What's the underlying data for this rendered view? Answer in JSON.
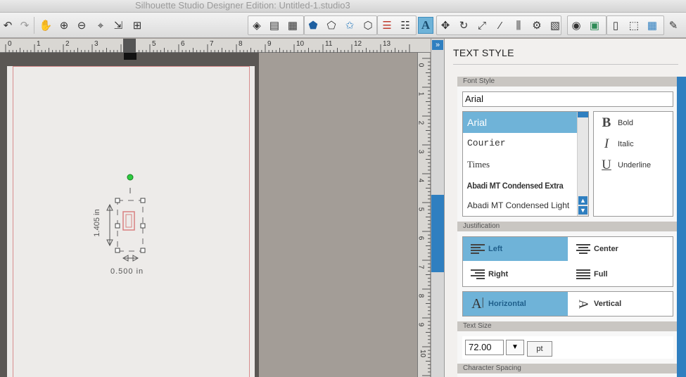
{
  "window": {
    "title": "Silhouette Studio Designer Edition: Untitled-1.studio3"
  },
  "ruler": {
    "horizontal": [
      "0",
      "1",
      "2",
      "3",
      "4",
      "5",
      "6",
      "7",
      "8",
      "9",
      "10",
      "11",
      "12",
      "13"
    ],
    "vertical": [
      "0",
      "1",
      "2",
      "3",
      "4",
      "5",
      "6",
      "7",
      "8",
      "9",
      "10"
    ]
  },
  "canvas": {
    "height_label": "1.405 in",
    "width_label": "0.500 in"
  },
  "panel": {
    "title": "TEXT STYLE",
    "font_style_header": "Font Style",
    "font_value": "Arial",
    "fonts": [
      "Arial",
      "Courier",
      "Times",
      "Abadi MT Condensed Extra",
      "Abadi MT Condensed Light"
    ],
    "selected_font": "Arial",
    "styles": [
      {
        "glyph": "B",
        "label": "Bold"
      },
      {
        "glyph": "I",
        "label": "Italic"
      },
      {
        "glyph": "U",
        "label": "Underline"
      }
    ],
    "justification_header": "Justification",
    "justification": [
      {
        "label": "Left",
        "selected": true
      },
      {
        "label": "Center",
        "selected": false
      },
      {
        "label": "Right",
        "selected": false
      },
      {
        "label": "Full",
        "selected": false
      }
    ],
    "direction": [
      {
        "label": "Horizontal",
        "selected": true
      },
      {
        "label": "Vertical",
        "selected": false
      }
    ],
    "text_size_header": "Text Size",
    "text_size_value": "72.00",
    "text_size_unit": "pt",
    "char_spacing_header": "Character Spacing"
  },
  "colors": {
    "accent": "#2f7fc0",
    "selected": "#6fb3d8",
    "cut_line": "#d78c8c",
    "rotate_handle": "#2ecc40"
  }
}
